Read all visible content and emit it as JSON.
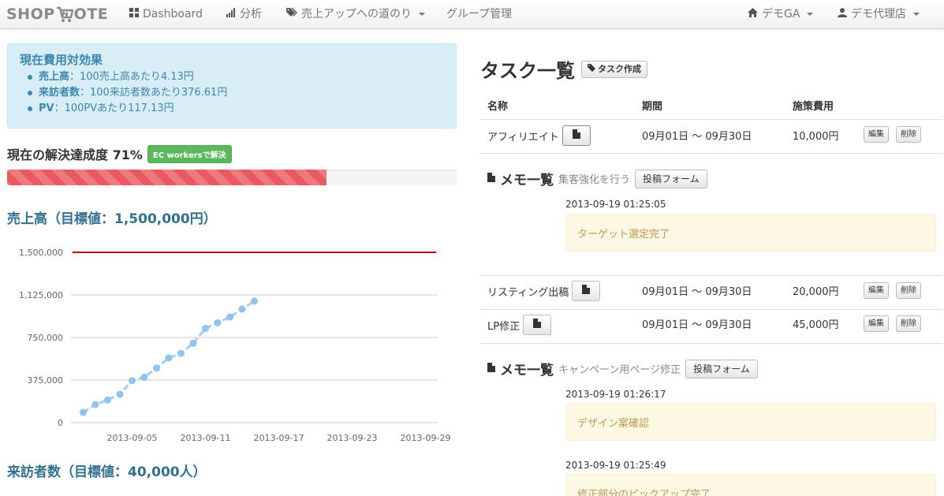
{
  "navbar": {
    "brand_left": "SHOP",
    "brand_right": "OTE",
    "dashboard": "Dashboard",
    "analysis": "分析",
    "road": "売上アップへの道のり",
    "group": "グループ管理",
    "demo_ga": "デモGA",
    "demo_agency": "デモ代理店"
  },
  "cost_effect": {
    "title": "現在費用対効果",
    "items": [
      {
        "label": "売上高",
        "text": "：100売上高あたり4.13円"
      },
      {
        "label": "来訪者数",
        "text": "：100来訪者数あたり376.61円"
      },
      {
        "label": "PV",
        "text": "：100PVあたり117.13円"
      }
    ]
  },
  "progress": {
    "heading": "現在の解決達成度 71%",
    "badge": "EC workersで解決",
    "value": 0.71
  },
  "sales_chart_title": "売上高（目標値：1,500,000円）",
  "visitors_chart_title": "来訪者数（目標値：40,000人）",
  "chart_data": {
    "type": "line",
    "title": "",
    "xlabel": "",
    "ylabel": "",
    "x_ticks": [
      "2013-09-05",
      "2013-09-11",
      "2013-09-17",
      "2013-09-23",
      "2013-09-29"
    ],
    "y_ticks": [
      "0",
      "375,000",
      "750,000",
      "1,125,000",
      "1,500,000"
    ],
    "ylim": [
      0,
      1500000
    ],
    "xlim": [
      "2013-08-31",
      "2013-09-30"
    ],
    "target": 1500000,
    "series": [
      {
        "x": [
          "2013-09-01",
          "2013-09-02",
          "2013-09-03",
          "2013-09-04",
          "2013-09-05",
          "2013-09-06",
          "2013-09-07",
          "2013-09-08",
          "2013-09-09",
          "2013-09-10",
          "2013-09-11",
          "2013-09-12",
          "2013-09-13",
          "2013-09-14",
          "2013-09-15"
        ],
        "values": [
          90000,
          160000,
          200000,
          250000,
          370000,
          400000,
          480000,
          570000,
          610000,
          700000,
          830000,
          880000,
          930000,
          1000000,
          1070000
        ]
      }
    ],
    "grid": true,
    "colors": {
      "line": "#a7cdf0",
      "marker": "#8fc3f0",
      "target": "#c00000"
    }
  },
  "tasks": {
    "title": "タスク一覧",
    "create_button": "タスク作成",
    "headers": {
      "name": "名称",
      "period": "期間",
      "cost": "施策費用"
    },
    "edit_label": "編集",
    "delete_label": "削除",
    "memo_heading": "メモ一覧",
    "post_form_label": "投稿フォーム",
    "rows": [
      {
        "name": "アフィリエイト",
        "period": "09月01日 〜 09月30日",
        "cost": "10,000円"
      },
      {
        "name": "リスティング出稿",
        "period": "09月01日 〜 09月30日",
        "cost": "20,000円"
      },
      {
        "name": "LP修正",
        "period": "09月01日 〜 09月30日",
        "cost": "45,000円"
      }
    ],
    "memo_groups": [
      {
        "subtitle": "集客強化を行う",
        "memos": [
          {
            "date": "2013-09-19 01:25:05",
            "text": "ターゲット選定完了"
          }
        ]
      },
      {
        "subtitle": "キャンペーン用ページ修正",
        "memos": [
          {
            "date": "2013-09-19 01:26:17",
            "text": "デザイン案確認"
          },
          {
            "date": "2013-09-19 01:25:49",
            "text": "修正部分のピックアップ完了"
          }
        ]
      }
    ]
  }
}
